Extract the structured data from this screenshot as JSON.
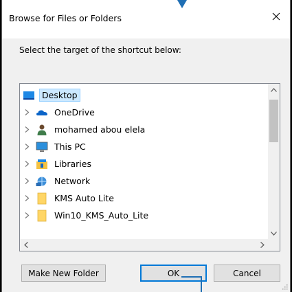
{
  "dialog": {
    "title": "Browse for Files or Folders",
    "prompt": "Select the target of the shortcut below:"
  },
  "tree": {
    "root": {
      "label": "Desktop",
      "icon": "desktop-icon",
      "selected": true
    },
    "items": [
      {
        "label": "OneDrive",
        "icon": "onedrive-cloud-icon"
      },
      {
        "label": "mohamed abou elela",
        "icon": "user-icon"
      },
      {
        "label": "This PC",
        "icon": "monitor-icon"
      },
      {
        "label": "Libraries",
        "icon": "libraries-icon"
      },
      {
        "label": "Network",
        "icon": "network-icon"
      },
      {
        "label": "KMS Auto Lite",
        "icon": "folder-icon"
      },
      {
        "label": "Win10_KMS_Auto_Lite",
        "icon": "folder-icon"
      }
    ]
  },
  "buttons": {
    "make_new_folder": "Make New Folder",
    "ok": "OK",
    "cancel": "Cancel"
  },
  "colors": {
    "selection_bg": "#cce8ff",
    "accent": "#0078d7",
    "callout": "#1f6fb4"
  }
}
